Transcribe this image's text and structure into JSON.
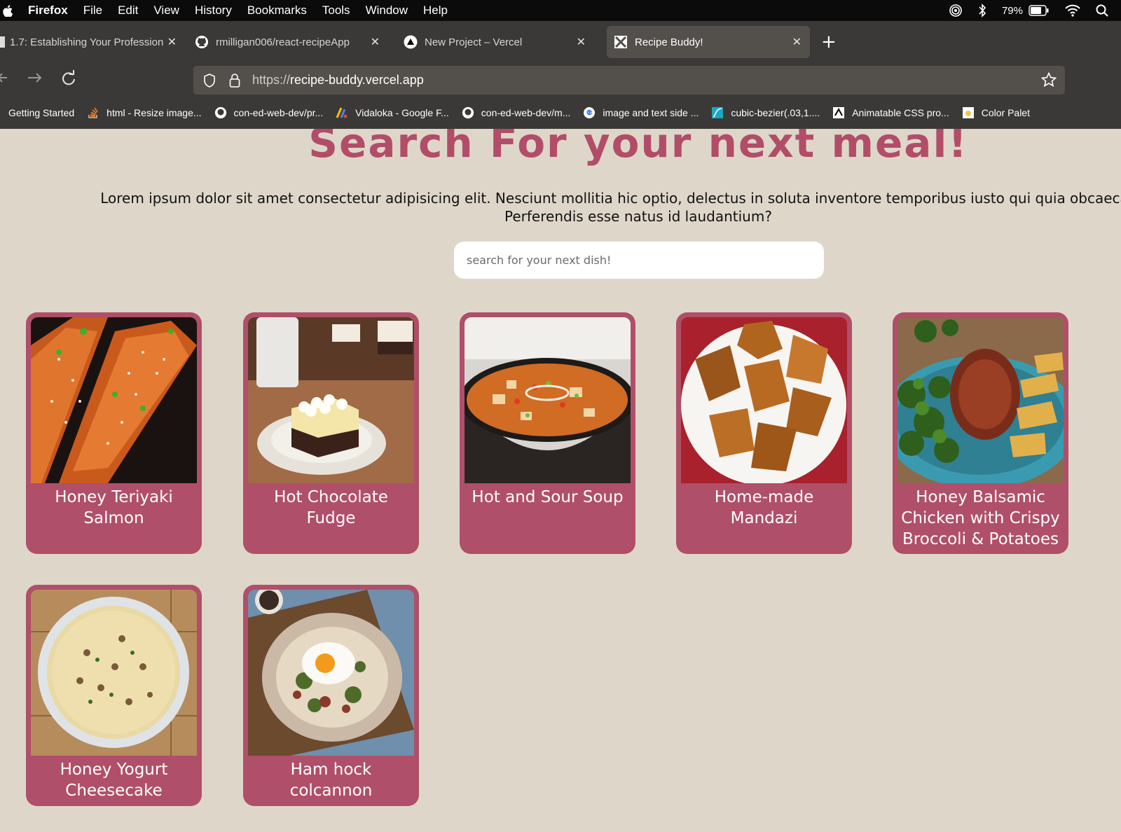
{
  "menubar": {
    "app": "Firefox",
    "items": [
      "File",
      "Edit",
      "View",
      "History",
      "Bookmarks",
      "Tools",
      "Window",
      "Help"
    ],
    "battery": "79%"
  },
  "tabs": [
    {
      "title": "1.7: Establishing Your Profession",
      "icon": "document-icon"
    },
    {
      "title": "rmilligan006/react-recipeApp",
      "icon": "github-icon"
    },
    {
      "title": "New Project – Vercel",
      "icon": "vercel-icon"
    },
    {
      "title": "Recipe Buddy!",
      "icon": "recipe-icon",
      "active": true
    }
  ],
  "urlbar": {
    "protocol": "https://",
    "domain": "recipe-buddy.vercel.app"
  },
  "bookmarks": [
    {
      "label": "Getting Started",
      "icon": "firefox-icon"
    },
    {
      "label": "html - Resize image...",
      "icon": "stackoverflow-icon"
    },
    {
      "label": "con-ed-web-dev/pr...",
      "icon": "github-icon"
    },
    {
      "label": "Vidaloka - Google F...",
      "icon": "google-fonts-icon"
    },
    {
      "label": "con-ed-web-dev/m...",
      "icon": "github-icon"
    },
    {
      "label": "image and text side ...",
      "icon": "google-icon"
    },
    {
      "label": "cubic-bezier(.03,1....",
      "icon": "cubic-bezier-icon"
    },
    {
      "label": "Animatable CSS pro...",
      "icon": "mdn-icon"
    },
    {
      "label": "Color Palet",
      "icon": "palette-icon"
    }
  ],
  "hero": {
    "title": "Search For your next meal!",
    "text_line1": "Lorem ipsum dolor sit amet consectetur adipisicing elit. Nesciunt mollitia hic optio, delectus in soluta inventore temporibus iusto qui quia obcaecati quo?",
    "text_line2": "Perferendis esse natus id laudantium?"
  },
  "search": {
    "placeholder": "search for your next dish!"
  },
  "recipes": [
    {
      "name": "Honey Teriyaki Salmon"
    },
    {
      "name": "Hot Chocolate Fudge"
    },
    {
      "name": "Hot and Sour Soup"
    },
    {
      "name": "Home-made Mandazi"
    },
    {
      "name": "Honey Balsamic Chicken with Crispy Broccoli & Potatoes"
    },
    {
      "name": "Honey Yogurt Cheesecake"
    },
    {
      "name": "Ham hock colcannon"
    }
  ],
  "colors": {
    "accent": "#b04f69",
    "title": "#b24d69",
    "background": "#ded7c9"
  }
}
